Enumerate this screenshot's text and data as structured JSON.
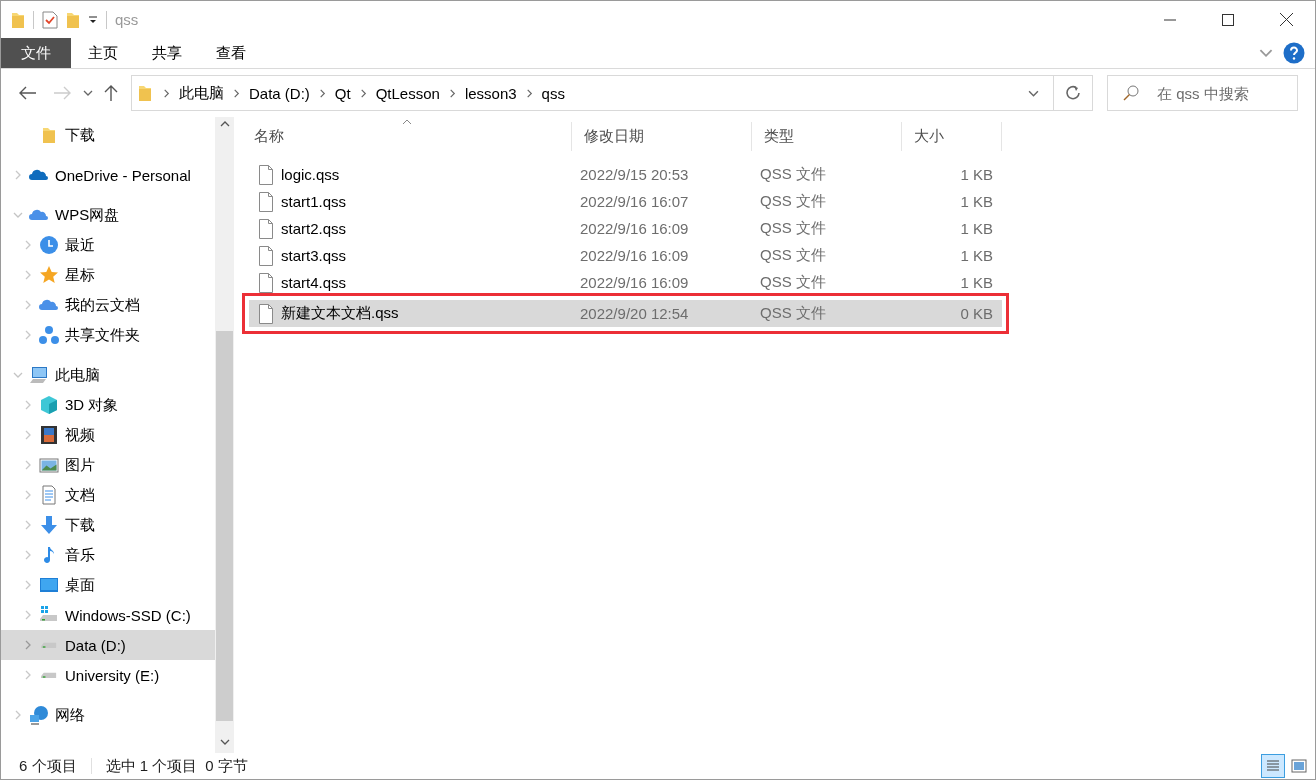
{
  "window": {
    "title": "qss"
  },
  "ribbon": {
    "tabs": [
      {
        "label": "文件",
        "kind": "file"
      },
      {
        "label": "主页",
        "kind": "tab"
      },
      {
        "label": "共享",
        "kind": "tab"
      },
      {
        "label": "查看",
        "kind": "tab"
      }
    ]
  },
  "navigation": {
    "back_disabled": false,
    "forward_disabled": true
  },
  "address_bar": {
    "path": [
      "此电脑",
      "Data (D:)",
      "Qt",
      "QtLesson",
      "lesson3",
      "qss"
    ]
  },
  "search": {
    "placeholder": "在 qss 中搜索"
  },
  "sidebar": {
    "items": [
      {
        "children": [
          {
            "label": "下载",
            "kind": "folder",
            "selected": false
          }
        ]
      },
      {
        "label": "OneDrive - Personal",
        "kind": "onedrive",
        "expanded": false,
        "selected": false
      },
      {
        "label": "WPS网盘",
        "kind": "cloud",
        "expanded": true,
        "selected": false,
        "children": [
          {
            "label": "最近",
            "kind": "clock",
            "expanded": false,
            "selected": false
          },
          {
            "label": "星标",
            "kind": "star",
            "expanded": false,
            "selected": false
          },
          {
            "label": "我的云文档",
            "kind": "cloud",
            "expanded": false,
            "selected": false
          },
          {
            "label": "共享文件夹",
            "kind": "share",
            "expanded": false,
            "selected": false
          }
        ]
      },
      {
        "label": "此电脑",
        "kind": "pc",
        "expanded": true,
        "selected": false,
        "children": [
          {
            "label": "3D 对象",
            "kind": "cube",
            "expanded": false,
            "selected": false
          },
          {
            "label": "视频",
            "kind": "video",
            "expanded": false,
            "selected": false
          },
          {
            "label": "图片",
            "kind": "picture",
            "expanded": false,
            "selected": false
          },
          {
            "label": "文档",
            "kind": "document",
            "expanded": false,
            "selected": false
          },
          {
            "label": "下载",
            "kind": "download",
            "expanded": false,
            "selected": false
          },
          {
            "label": "音乐",
            "kind": "music",
            "expanded": false,
            "selected": false
          },
          {
            "label": "桌面",
            "kind": "desktop",
            "expanded": false,
            "selected": false
          },
          {
            "label": "Windows-SSD (C:)",
            "kind": "system-drive",
            "expanded": false,
            "selected": false
          },
          {
            "label": "Data (D:)",
            "kind": "drive",
            "expanded": false,
            "selected": true
          },
          {
            "label": "University (E:)",
            "kind": "drive",
            "expanded": false,
            "selected": false
          }
        ]
      },
      {
        "label": "网络",
        "kind": "network",
        "expanded": false,
        "selected": false
      }
    ]
  },
  "file_list": {
    "columns": [
      {
        "label": "名称",
        "sorted": true
      },
      {
        "label": "修改日期",
        "sorted": false
      },
      {
        "label": "类型",
        "sorted": false
      },
      {
        "label": "大小",
        "sorted": false
      }
    ],
    "rows": [
      {
        "name": "logic.qss",
        "modified": "2022/9/15 20:53",
        "type": "QSS 文件",
        "size": "1 KB",
        "selected": false,
        "outlined": false
      },
      {
        "name": "start1.qss",
        "modified": "2022/9/16 16:07",
        "type": "QSS 文件",
        "size": "1 KB",
        "selected": false,
        "outlined": false
      },
      {
        "name": "start2.qss",
        "modified": "2022/9/16 16:09",
        "type": "QSS 文件",
        "size": "1 KB",
        "selected": false,
        "outlined": false
      },
      {
        "name": "start3.qss",
        "modified": "2022/9/16 16:09",
        "type": "QSS 文件",
        "size": "1 KB",
        "selected": false,
        "outlined": false
      },
      {
        "name": "start4.qss",
        "modified": "2022/9/16 16:09",
        "type": "QSS 文件",
        "size": "1 KB",
        "selected": false,
        "outlined": false
      },
      {
        "name": "新建文本文档.qss",
        "modified": "2022/9/20 12:54",
        "type": "QSS 文件",
        "size": "0 KB",
        "selected": true,
        "outlined": true
      }
    ]
  },
  "status_bar": {
    "item_count": "6 个项目",
    "selection": "选中 1 个项目",
    "selection_size": "0 字节",
    "views": [
      {
        "kind": "details",
        "selected": true
      },
      {
        "kind": "large-icons",
        "selected": false
      }
    ]
  }
}
